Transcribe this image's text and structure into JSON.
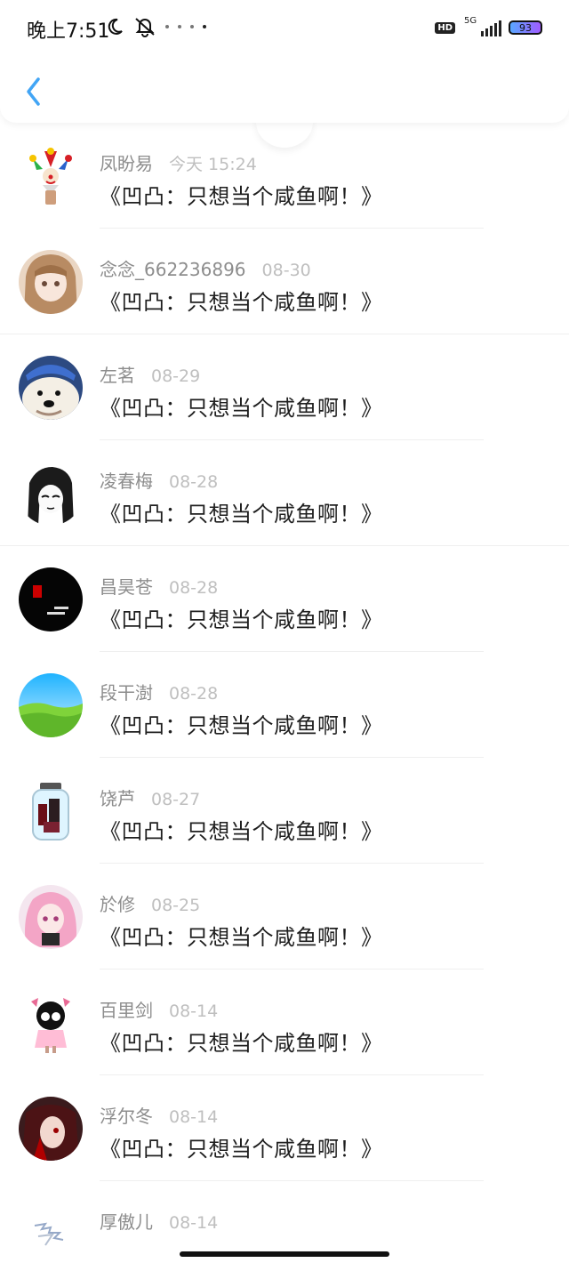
{
  "status_bar": {
    "time": "晚上7:51",
    "hd_badge": "HD",
    "network": "5G",
    "battery": "93"
  },
  "list": {
    "items": [
      {
        "name": "凤盼易",
        "time": "今天 15:24",
        "message": "《凹凸：只想当个咸鱼啊！》",
        "avatar_icon": "clown-avatar-icon"
      },
      {
        "name": "念念_662236896",
        "time": "08-30",
        "message": "《凹凸：只想当个咸鱼啊！》",
        "avatar_icon": "anime-girl-avatar-icon"
      },
      {
        "name": "左茗",
        "time": "08-29",
        "message": "《凹凸：只想当个咸鱼啊！》",
        "avatar_icon": "dog-avatar-icon"
      },
      {
        "name": "凌春梅",
        "time": "08-28",
        "message": "《凹凸：只想当个咸鱼啊！》",
        "avatar_icon": "sketch-girl-avatar-icon"
      },
      {
        "name": "昌昊苍",
        "time": "08-28",
        "message": "《凹凸：只想当个咸鱼啊！》",
        "avatar_icon": "dark-text-avatar-icon"
      },
      {
        "name": "段干澍",
        "time": "08-28",
        "message": "《凹凸：只想当个咸鱼啊！》",
        "avatar_icon": "grass-sky-avatar-icon"
      },
      {
        "name": "饶芦",
        "time": "08-27",
        "message": "《凹凸：只想当个咸鱼啊！》",
        "avatar_icon": "jar-avatar-icon"
      },
      {
        "name": "於修",
        "time": "08-25",
        "message": "《凹凸：只想当个咸鱼啊！》",
        "avatar_icon": "pink-hair-avatar-icon"
      },
      {
        "name": "百里剑",
        "time": "08-14",
        "message": "《凹凸：只想当个咸鱼啊！》",
        "avatar_icon": "cute-girl-avatar-icon"
      },
      {
        "name": "浮尔冬",
        "time": "08-14",
        "message": "《凹凸：只想当个咸鱼啊！》",
        "avatar_icon": "red-eye-avatar-icon"
      },
      {
        "name": "厚傲儿",
        "time": "08-14",
        "message": "",
        "avatar_icon": "sketch-avatar-icon"
      }
    ]
  }
}
